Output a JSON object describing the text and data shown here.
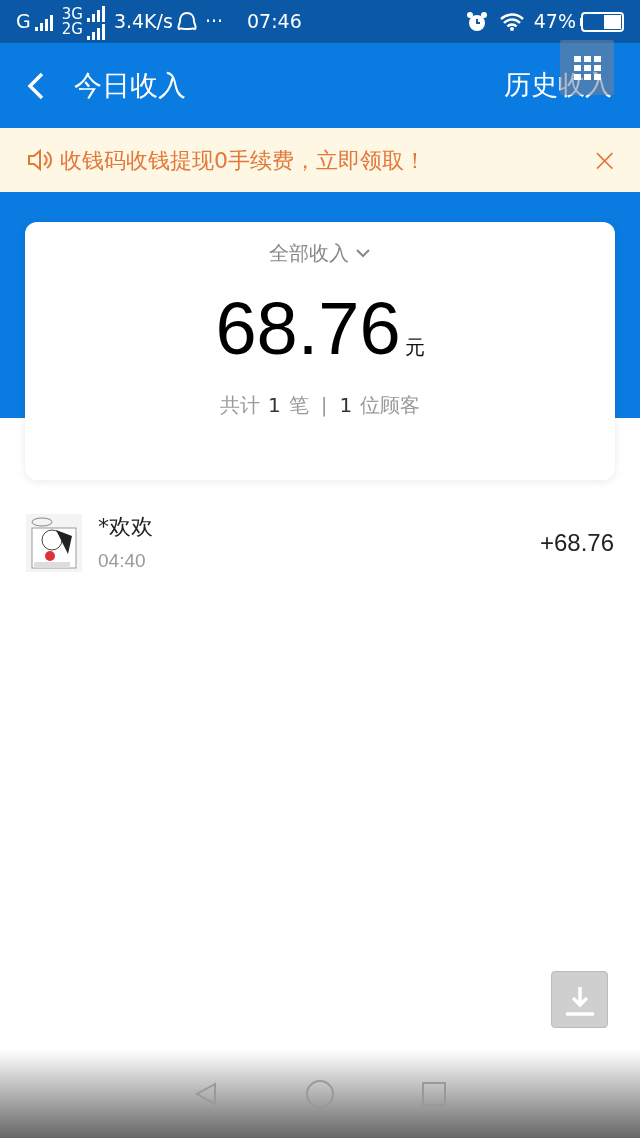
{
  "status_bar": {
    "network_1": "G",
    "network_2": "3G",
    "network_3": "2G",
    "speed": "3.4K/s",
    "more": "···",
    "time": "07:46",
    "battery": "47%"
  },
  "header": {
    "title": "今日收入",
    "action": "历史收入"
  },
  "notice": {
    "text": "收钱码收钱提现0手续费，立即领取！",
    "close": "×"
  },
  "summary": {
    "filter": "全部收入",
    "amount": "68.76",
    "unit": "元",
    "stats": [
      {
        "kind": "text",
        "text": "共计"
      },
      {
        "kind": "num",
        "text": "1"
      },
      {
        "kind": "text",
        "text": "笔"
      },
      {
        "kind": "sep",
        "text": "|"
      },
      {
        "kind": "num",
        "text": "1"
      },
      {
        "kind": "text",
        "text": "位顾客"
      }
    ]
  },
  "transactions": [
    {
      "name": "*欢欢",
      "time": "04:40",
      "amount": "+68.76"
    }
  ]
}
